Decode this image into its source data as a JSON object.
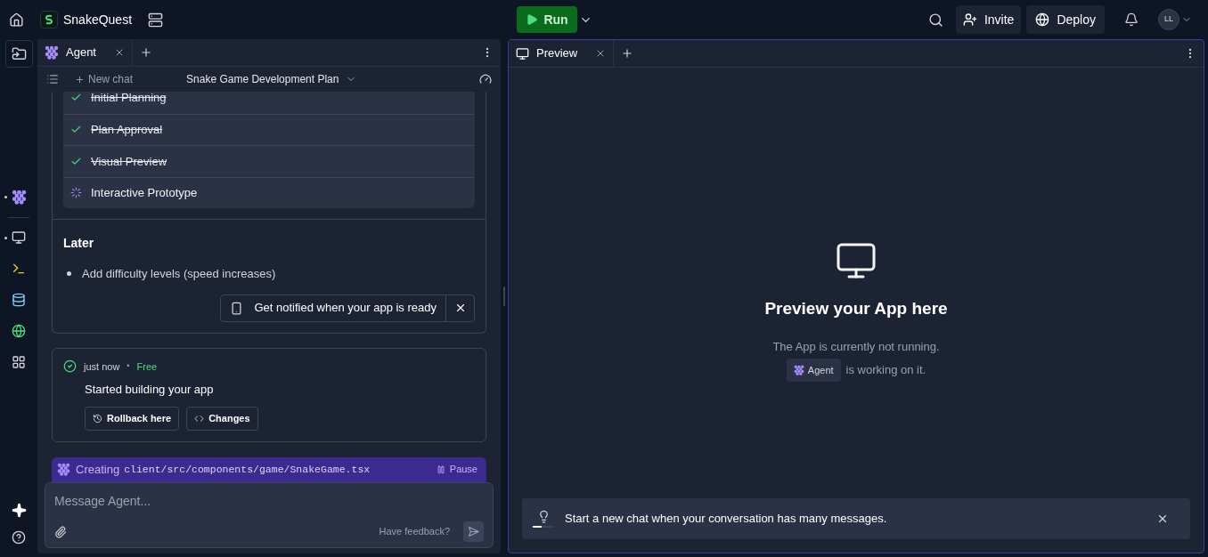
{
  "top_bar": {
    "project": "SnakeQuest",
    "run": "Run",
    "invite": "Invite",
    "deploy": "Deploy",
    "avatar": "LL"
  },
  "agent_panel": {
    "tab": {
      "label": "Agent",
      "selected": true
    },
    "new_chat": "New chat",
    "chat_title": "Snake Game Development Plan",
    "tasks": [
      {
        "label": "Initial Planning",
        "done": true
      },
      {
        "label": "Plan Approval",
        "done": true
      },
      {
        "label": "Visual Preview",
        "done": true
      },
      {
        "label": "Interactive Prototype",
        "done": false
      }
    ],
    "later": {
      "heading": "Later",
      "items": [
        "Add difficulty levels (speed increases)"
      ]
    },
    "notify": "Get notified when your app is ready",
    "checkpoint": {
      "time": "just now",
      "separator": "•",
      "cost": "Free",
      "message": "Started building your app",
      "buttons": [
        {
          "kind": "rollback",
          "label": "Rollback here"
        },
        {
          "kind": "changes",
          "label": "Changes"
        }
      ]
    },
    "status": {
      "action": "Creating",
      "path": "client/src/components/game/SnakeGame.tsx",
      "pause": "Pause"
    },
    "input": {
      "placeholder": "Message Agent...",
      "feedback": "Have feedback?"
    }
  },
  "preview_panel": {
    "tab": {
      "label": "Preview",
      "selected": true
    },
    "title": "Preview your App here",
    "line1": "The App is currently not running.",
    "agent_badge": "Agent",
    "line2": "is working on it.",
    "tip": {
      "text": "Start a new chat when your conversation has many messages.",
      "level": 0.4
    }
  }
}
